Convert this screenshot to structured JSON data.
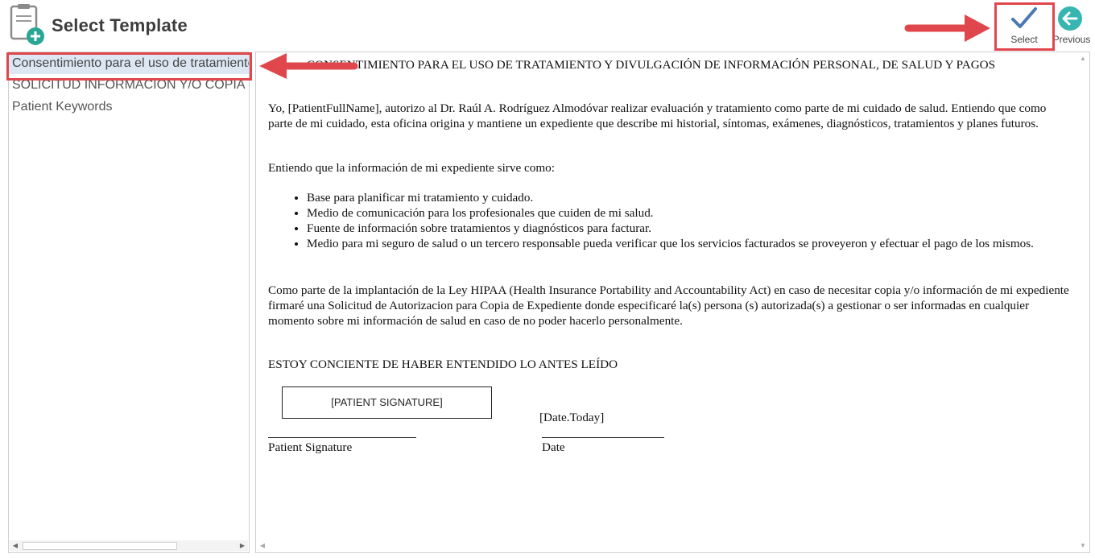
{
  "header": {
    "title": "Select Template"
  },
  "toolbar": {
    "select_label": "Select",
    "previous_label": "Previous"
  },
  "templates": [
    {
      "label": "Consentimiento para el uso de tratamiento y divulgación"
    },
    {
      "label": "SOLICITUD INFORMACION Y/O COPIA EXPEDIENTE"
    },
    {
      "label": "Patient Keywords"
    }
  ],
  "document": {
    "title": "CONSENTIMIENTO PARA EL USO DE TRATAMIENTO Y DIVULGACIÓN DE INFORMACIÓN PERSONAL, DE SALUD Y PAGOS",
    "paragraph1": "Yo, [PatientFullName], autorizo al Dr. Raúl A. Rodríguez Almodóvar realizar evaluación y tratamiento como parte de mi cuidado de salud.  Entiendo que como parte de mi cuidado, esta oficina origina y mantiene un expediente que describe mi historial, síntomas, exámenes, diagnósticos, tratamientos y planes futuros.",
    "paragraph2": "Entiendo que la información de mi expediente sirve como:",
    "bullets": [
      "Base para planificar mi tratamiento y cuidado.",
      "Medio de comunicación para los profesionales que cuiden de mi salud.",
      "Fuente de información sobre tratamientos y diagnósticos para facturar.",
      "Medio para mi seguro de salud o un tercero responsable pueda verificar que los servicios      facturados se proveyeron y efectuar el pago de los mismos."
    ],
    "paragraph3": "Como parte de la implantación de la Ley HIPAA (Health Insurance Portability and Accountability Act) en caso de necesitar copia y/o información de mi expediente firmaré una Solicitud de Autorizacion para Copia de Expediente donde especificaré la(s) persona (s) autorizada(s) a gestionar o ser informadas en cualquier momento sobre mi información de salud en caso de no poder hacerlo personalmente.",
    "acknowledgement": "ESTOY CONCIENTE DE HABER ENTENDIDO LO ANTES LEÍDO",
    "signature_placeholder": "[PATIENT SIGNATURE]",
    "date_placeholder": "[Date.Today]",
    "signature_label": "Patient Signature",
    "date_label": "Date"
  },
  "colors": {
    "highlight": "#e0474c",
    "selected_row": "#dde7f3",
    "check_blue": "#4b79b5",
    "previous_teal": "#37b5b0",
    "plus_green": "#2aa794"
  }
}
